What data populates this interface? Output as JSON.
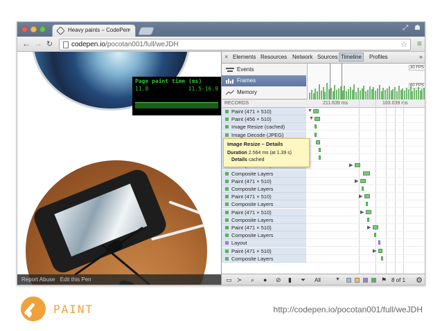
{
  "browser": {
    "tab_title": "Heavy paints – CodePen",
    "tab_close": "×",
    "url_host": "codepen.io",
    "url_path": "/pocotan001/full/weJDH"
  },
  "page": {
    "fps_title": "Page paint time (ms)",
    "fps_value": "11.8",
    "fps_range": "11.5-16.9",
    "footer_links": [
      "Report Abuse",
      "Edit this Pen"
    ]
  },
  "devtools": {
    "close": "×",
    "tabs": [
      "Elements",
      "Resources",
      "Network",
      "Sources",
      "Timeline",
      "Profiles"
    ],
    "active_tab": "Timeline",
    "more": "»",
    "overview_items": [
      "Events",
      "Frames",
      "Memory"
    ],
    "fps_30": "30 FPS",
    "fps_60": "60 FPS",
    "records_label": "RECORDS",
    "time_1": "211.639 ms",
    "time_2": "183.039 ms",
    "records": [
      {
        "name": "Paint (471 × 510)",
        "color": "#5db05d"
      },
      {
        "name": "Paint (456 × 510)",
        "color": "#5db05d"
      },
      {
        "name": "Image Resize (cached)",
        "color": "#5db05d"
      },
      {
        "name": "Image Decode (JPEG)",
        "color": "#5db05d"
      },
      {
        "name": "Paint (471 × 510)",
        "color": "#5db05d"
      },
      {
        "name": "Composite Layers",
        "color": "#5db05d"
      },
      {
        "name": "Composite Layers",
        "color": "#5db05d"
      },
      {
        "name": "Paint (471 × 510)",
        "color": "#5db05d"
      },
      {
        "name": "Composite Layers",
        "color": "#5db05d"
      },
      {
        "name": "Paint (471 × 510)",
        "color": "#5db05d"
      },
      {
        "name": "Composite Layers",
        "color": "#5db05d"
      },
      {
        "name": "Paint (471 × 510)",
        "color": "#5db05d"
      },
      {
        "name": "Composite Layers",
        "color": "#5db05d"
      },
      {
        "name": "Paint (471 × 510)",
        "color": "#5db05d"
      },
      {
        "name": "Composite Layers",
        "color": "#5db05d"
      },
      {
        "name": "Paint (471 × 510)",
        "color": "#5db05d"
      },
      {
        "name": "Composite Layers",
        "color": "#5db05d"
      },
      {
        "name": "Layout",
        "color": "#9a7fd1"
      },
      {
        "name": "Paint (471 × 510)",
        "color": "#5db05d"
      },
      {
        "name": "Composite Layers",
        "color": "#5db05d"
      }
    ],
    "tooltip": {
      "title": "Image Resize – Details",
      "duration_label": "Duration",
      "duration_value": "2.564 ms (at 1.39 s)",
      "details_label": "Details",
      "details_value": "cached"
    },
    "filter": "All",
    "record_count": "8 of 1",
    "swatch_colors": [
      "#9fb7e6",
      "#f2c14e",
      "#9a7fd1",
      "#5db05d"
    ]
  },
  "slide": {
    "title": "PAINT",
    "url": "http://codepen.io/pocotan001/full/weJDH",
    "accent": "#f0a13a"
  }
}
